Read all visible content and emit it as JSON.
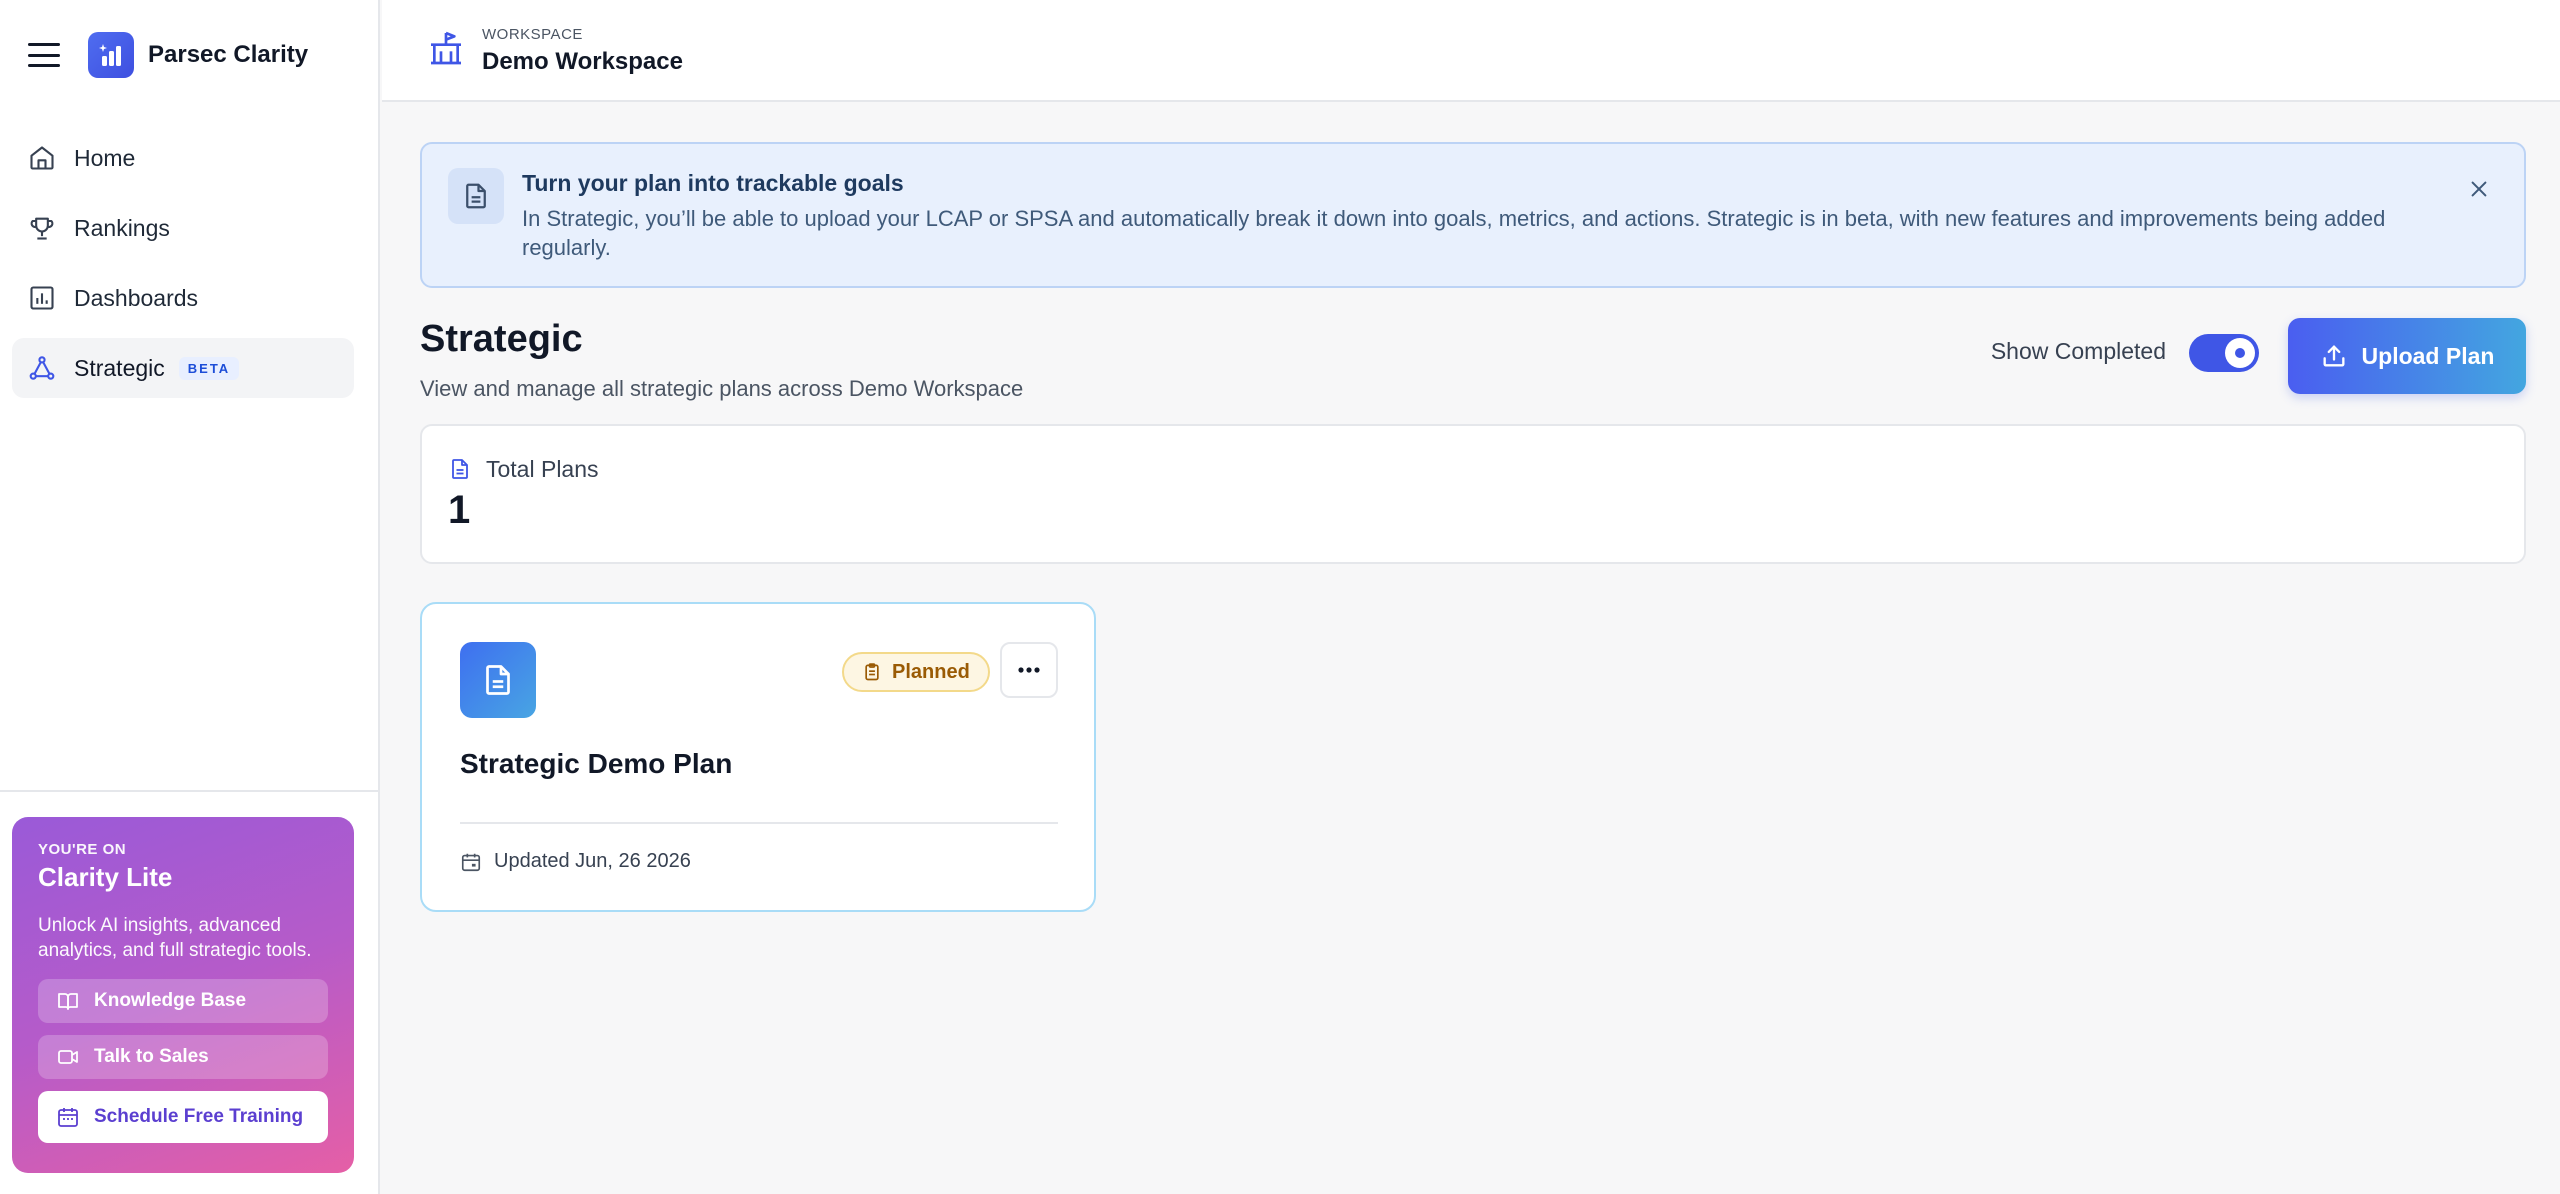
{
  "app": {
    "name": "Parsec Clarity"
  },
  "sidebar": {
    "items": [
      {
        "label": "Home",
        "icon": "home-icon"
      },
      {
        "label": "Rankings",
        "icon": "trophy-icon"
      },
      {
        "label": "Dashboards",
        "icon": "chart-icon"
      },
      {
        "label": "Strategic",
        "icon": "network-icon",
        "badge": "BETA",
        "active": true
      }
    ],
    "promo": {
      "kicker": "YOU'RE ON",
      "title": "Clarity Lite",
      "description": "Unlock AI insights, advanced analytics, and full strategic tools.",
      "knowledge_base": "Knowledge Base",
      "talk_to_sales": "Talk to Sales",
      "schedule_training": "Schedule Free Training"
    }
  },
  "header": {
    "workspace_label": "WORKSPACE",
    "workspace_name": "Demo Workspace"
  },
  "banner": {
    "title": "Turn your plan into trackable goals",
    "text": "In Strategic, you’ll be able to upload your LCAP or SPSA and automatically break it down into goals, metrics, and actions. Strategic is in beta, with new features and improvements being added regularly."
  },
  "page": {
    "title": "Strategic",
    "subtitle": "View and manage all strategic plans across Demo Workspace",
    "show_completed_label": "Show Completed",
    "show_completed": true,
    "upload_label": "Upload Plan"
  },
  "stats": {
    "total_plans_label": "Total Plans",
    "total_plans_value": "1"
  },
  "plans": [
    {
      "title": "Strategic Demo Plan",
      "status": "Planned",
      "updated": "Updated Jun, 26 2026"
    }
  ],
  "colors": {
    "accent": "#3f56e6",
    "badge_bg": "#fdf6e3",
    "badge_text": "#9a5b05",
    "banner_bg": "#e8f0fd"
  }
}
